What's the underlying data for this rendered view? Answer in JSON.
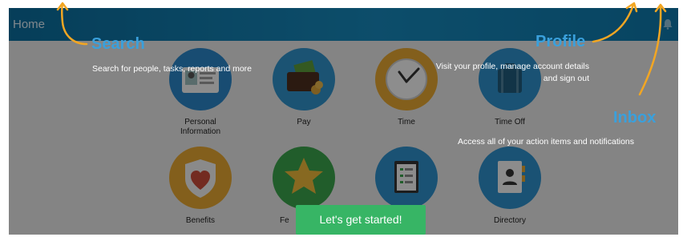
{
  "header": {
    "home_label": "Home"
  },
  "tiles_row1": [
    "Personal Information",
    "Pay",
    "Time",
    "Time Off"
  ],
  "tiles_row2": [
    "Benefits",
    "Fe",
    "",
    "Directory"
  ],
  "tiles_row1_display": [
    "Personal\nInformation",
    "Pay",
    "Time",
    "Time Off"
  ],
  "callouts": {
    "search": {
      "title": "Search",
      "text": "Search for people, tasks, reports and more"
    },
    "profile": {
      "title": "Profile",
      "text_line1": "Visit your profile, manage account details",
      "text_line2": "and sign out"
    },
    "inbox": {
      "title": "Inbox",
      "text": "Access all of your action items and notifications"
    }
  },
  "cta_label": "Let's get started!",
  "colors": {
    "accent": "#3aa0dc",
    "cta": "#37b565",
    "arrow": "#f2a623",
    "header": "#1786b8"
  }
}
